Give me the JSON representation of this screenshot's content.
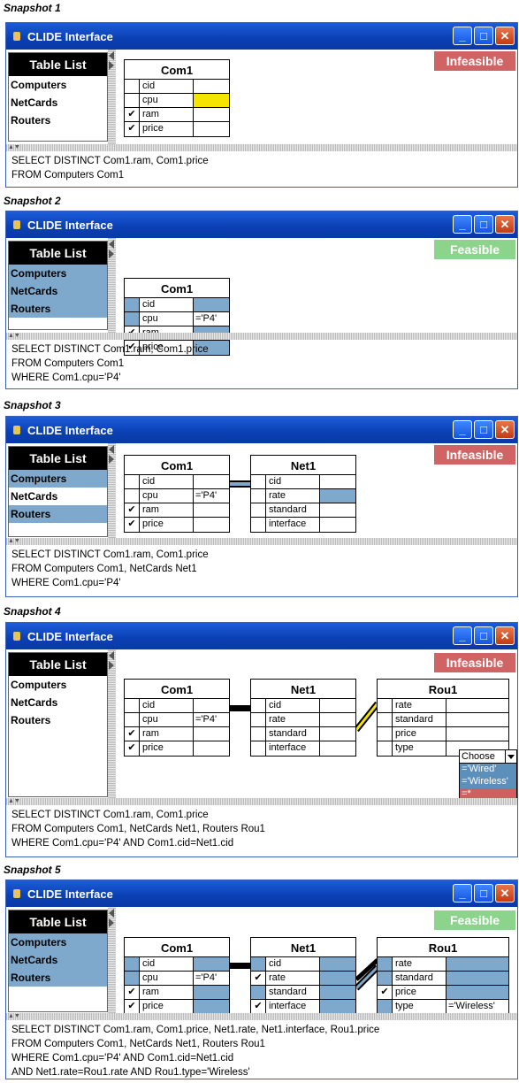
{
  "colors": {
    "infeasible": "#d06464",
    "feasible": "#8cd48c",
    "selected": "#7fa9cc",
    "highlight": "#f5e400",
    "window_title": "#0b3fb3"
  },
  "window": {
    "title": "CLIDE Interface",
    "minimize_icon": "minimize-icon",
    "maximize_icon": "maximize-icon",
    "close_icon": "close-icon"
  },
  "sidebar": {
    "title": "Table List",
    "items": [
      "Computers",
      "NetCards",
      "Routers"
    ]
  },
  "columns": {
    "com": [
      "cid",
      "cpu",
      "ram",
      "price"
    ],
    "net": [
      "cid",
      "rate",
      "standard",
      "interface"
    ],
    "rou": [
      "rate",
      "standard",
      "price",
      "type"
    ]
  },
  "tables": {
    "com1": "Com1",
    "net1": "Net1",
    "rou1": "Rou1"
  },
  "checkmark": "✔",
  "conditions": {
    "cpu": "='P4'",
    "type": "='Wireless'"
  },
  "dropdown": {
    "label": "Choose",
    "options": [
      "='Wired'",
      "='Wireless'",
      "=*"
    ]
  },
  "snapshots": [
    {
      "label": "Snapshot 1",
      "status": "Infeasible",
      "sql": [
        "SELECT DISTINCT Com1.ram, Com1.price",
        "FROM Computers Com1"
      ]
    },
    {
      "label": "Snapshot 2",
      "status": "Feasible",
      "sql": [
        "SELECT DISTINCT Com1.ram, Com1.price",
        "FROM Computers Com1",
        "WHERE  Com1.cpu='P4'"
      ]
    },
    {
      "label": "Snapshot 3",
      "status": "Infeasible",
      "sql": [
        "SELECT DISTINCT Com1.ram, Com1.price",
        "FROM Computers Com1, NetCards Net1",
        "WHERE  Com1.cpu='P4'"
      ]
    },
    {
      "label": "Snapshot 4",
      "status": "Infeasible",
      "sql": [
        "SELECT DISTINCT Com1.ram, Com1.price",
        "FROM Computers Com1, NetCards Net1, Routers Rou1",
        "WHERE  Com1.cpu='P4' AND Com1.cid=Net1.cid"
      ]
    },
    {
      "label": "Snapshot 5",
      "status": "Feasible",
      "sql": [
        "SELECT DISTINCT Com1.ram, Com1.price, Net1.rate, Net1.interface, Rou1.price",
        "FROM Computers Com1, NetCards Net1, Routers Rou1",
        "WHERE  Com1.cpu='P4' AND Com1.cid=Net1.cid",
        "AND Net1.rate=Rou1.rate AND Rou1.type='Wireless'"
      ]
    }
  ]
}
